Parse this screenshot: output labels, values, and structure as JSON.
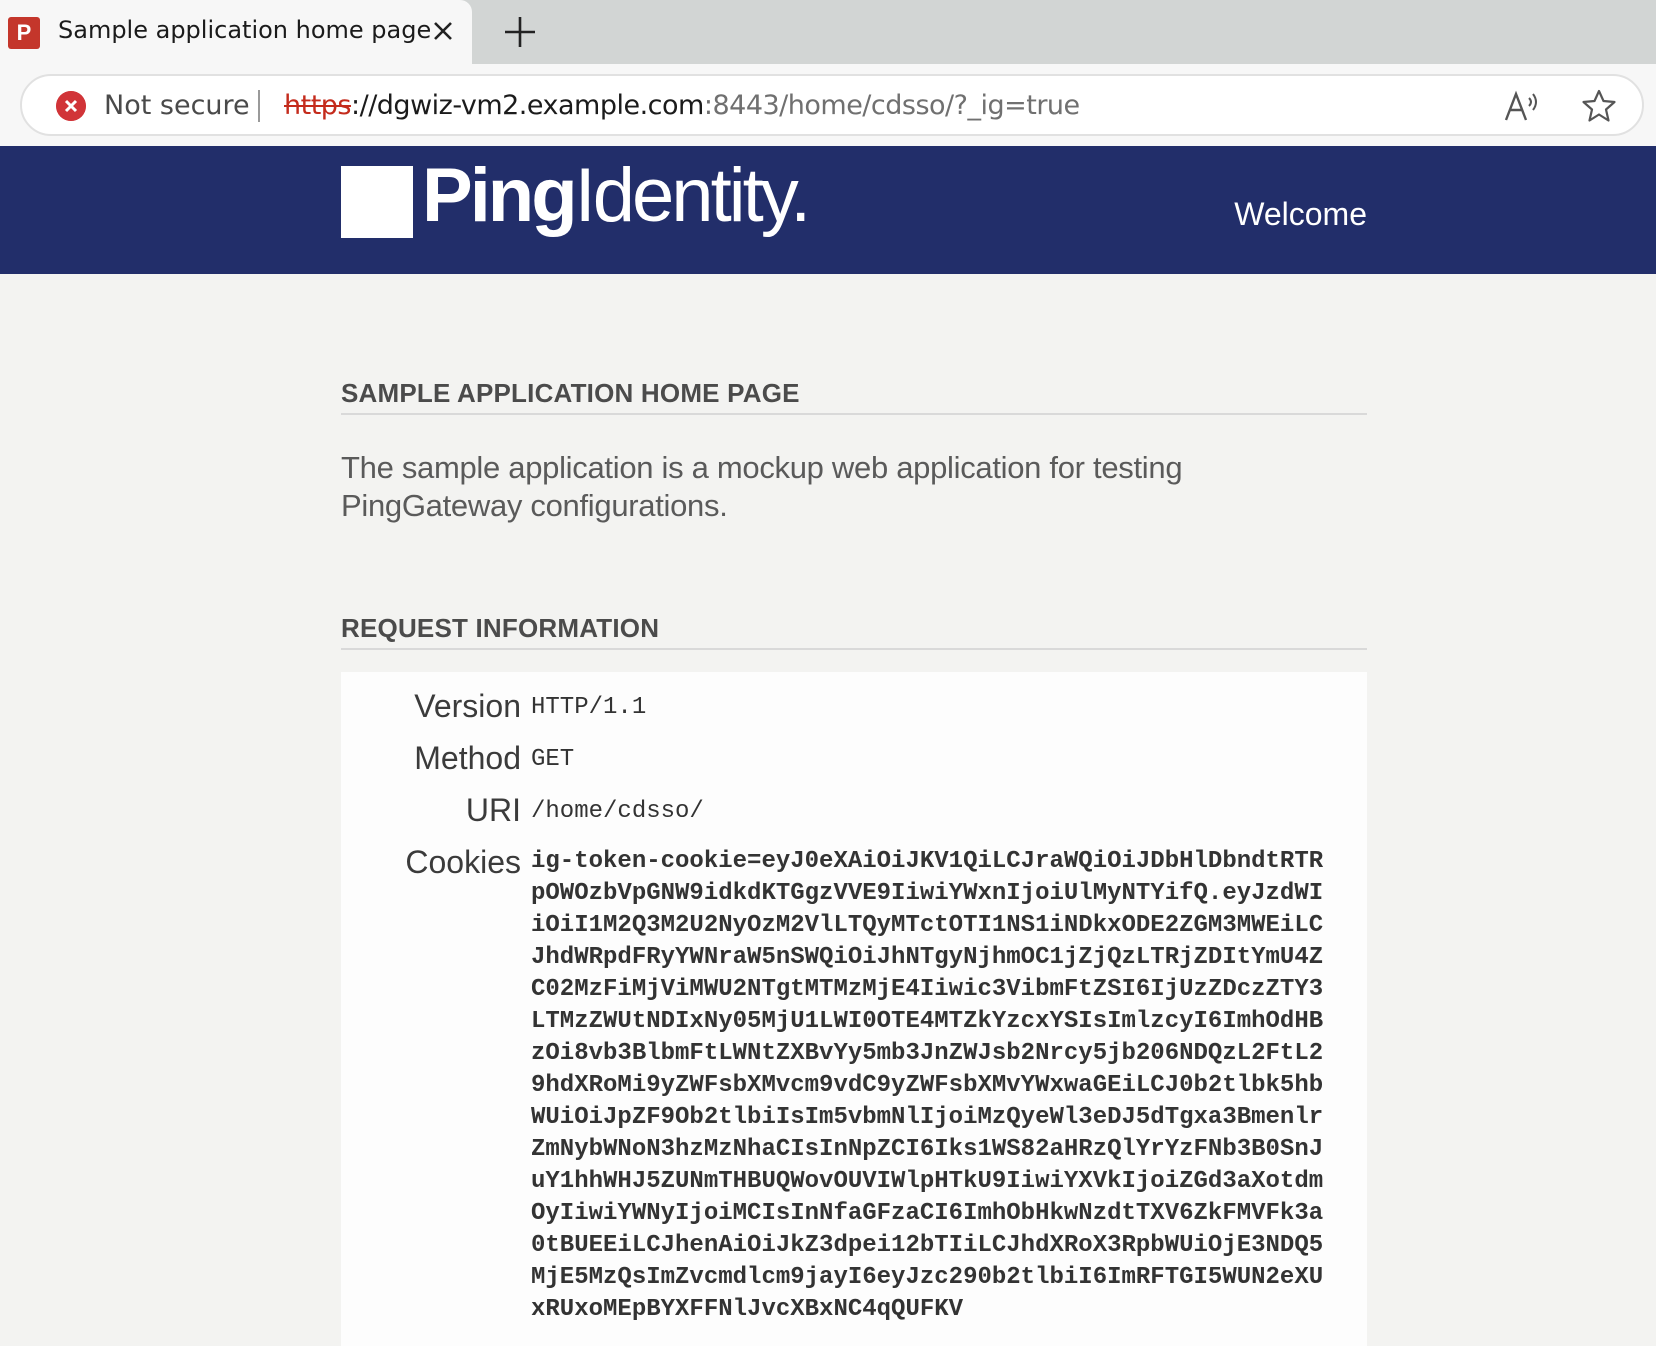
{
  "browser": {
    "tab_title": "Sample application home page",
    "favicon_letter": "P",
    "security_label": "Not secure",
    "url": {
      "scheme": "https",
      "separator": "://",
      "host": "dgwiz-vm2.example.com",
      "rest": ":8443/home/cdsso/?_ig=true"
    },
    "icons": [
      "close-icon",
      "plus-icon",
      "error-icon",
      "read-aloud-icon",
      "star-icon"
    ]
  },
  "header": {
    "logo_bold": "Ping",
    "logo_light": "Identity",
    "logo_mark": ".",
    "welcome": "Welcome"
  },
  "home": {
    "title": "SAMPLE APPLICATION HOME PAGE",
    "description": "The sample application is a mockup web application for testing PingGateway configurations."
  },
  "request": {
    "title": "REQUEST INFORMATION",
    "rows": [
      {
        "label": "Version",
        "value": "HTTP/1.1"
      },
      {
        "label": "Method",
        "value": "GET"
      },
      {
        "label": "URI",
        "value": "/home/cdsso/"
      },
      {
        "label": "Cookies",
        "value": "ig-token-cookie=eyJ0eXAiOiJKV1QiLCJraWQiOiJDbHlDbndtRTRpOWOzbVpGNW9idkdKTGgzVVE9IiwiYWxnIjoiUlMyNTYifQ.eyJzdWIiOiI1M2Q3M2U2NyOzM2VlLTQyMTctOTI1NS1iNDkxODE2ZGM3MWEiLCJhdWRpdFRyYWNraW5nSWQiOiJhNTgyNjhmOC1jZjQzLTRjZDItYmU4ZC02MzFiMjViMWU2NTgtMTMzMjE4Iiwic3VibmFtZSI6IjUzZDczZTY3LTMzZWUtNDIxNy05MjU1LWI0OTE4MTZkYzcxYSIsImlzcyI6ImhOdHBzOi8vb3BlbmFtLWNtZXBvYy5mb3JnZWJsb2Nrcy5jb206NDQzL2FtL29hdXRoMi9yZWFsbXMvcm9vdC9yZWFsbXMvYWxwaGEiLCJ0b2tlbk5hbWUiOiJpZF9Ob2tlbiIsIm5vbmNlIjoiMzQyeWl3eDJ5dTgxa3BmenlrZmNybWNoN3hzMzNhaCIsInNpZCI6Iks1WS82aHRzQlYrYzFNb3B0SnJuY1hhWHJ5ZUNmTHBUQWovOUVIWlpHTkU9IiwiYXVkIjoiZGd3aXotdmOyIiwiYWNyIjoiMCIsInNfaGFzaCI6ImhObHkwNzdtTXV6ZkFMVFk3a0tBUEEiLCJhenAiOiJkZ3dpei12bTIiLCJhdXRoX3RpbWUiOjE3NDQ5MjE5MzQsImZvcmdlcm9jayI6eyJzc290b2tlbiI6ImRFTGI5WUN2eXUxRUxoMEpBYXFFNlJvcXBxNC4qQUFKV"
      }
    ]
  }
}
